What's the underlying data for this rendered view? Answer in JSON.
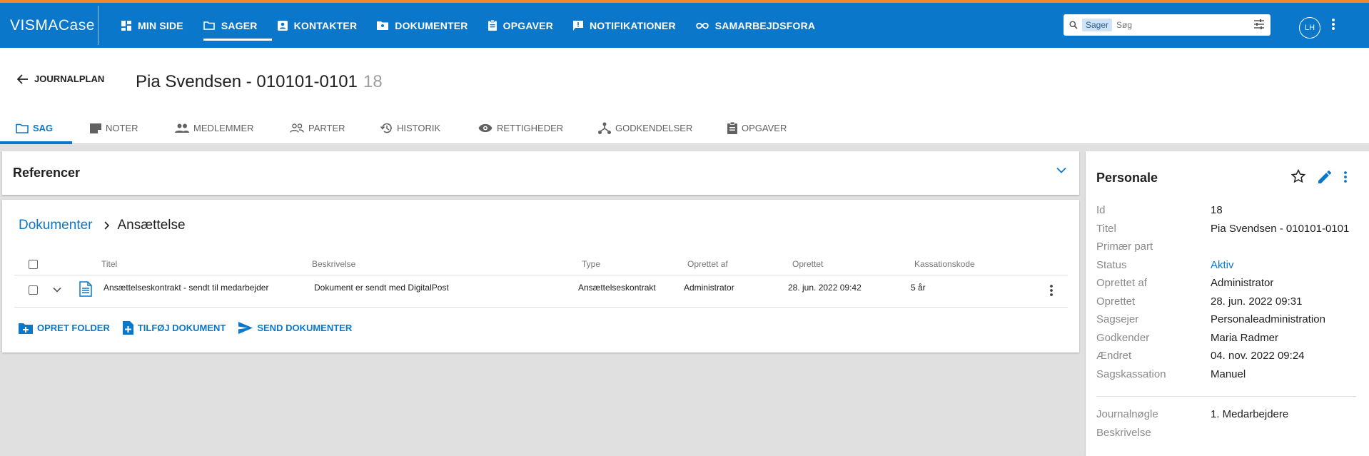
{
  "app": {
    "logo_primary": "VISMA",
    "logo_secondary": "Case",
    "colors": {
      "brand": "#0a77cb",
      "accent_stripe": "#f0872a"
    }
  },
  "topnav": {
    "items": [
      {
        "label": "MIN SIDE",
        "icon": "dashboard-icon"
      },
      {
        "label": "SAGER",
        "icon": "folder-icon",
        "active": true
      },
      {
        "label": "KONTAKTER",
        "icon": "contact-card-icon"
      },
      {
        "label": "DOKUMENTER",
        "icon": "document-folder-icon"
      },
      {
        "label": "OPGAVER",
        "icon": "clipboard-icon"
      },
      {
        "label": "NOTIFIKATIONER",
        "icon": "notification-icon"
      },
      {
        "label": "SAMARBEJDSFORA",
        "icon": "infinity-icon"
      }
    ],
    "search": {
      "scope_chip": "Sager",
      "placeholder": "Søg"
    },
    "avatar_initials": "LH"
  },
  "header": {
    "back_label": "JOURNALPLAN",
    "case_title": "Pia Svendsen - 010101-0101",
    "case_id": "18",
    "tabs": [
      {
        "label": "SAG",
        "icon": "folder-outline-icon",
        "active": true
      },
      {
        "label": "NOTER",
        "icon": "note-icon"
      },
      {
        "label": "MEDLEMMER",
        "icon": "people-icon"
      },
      {
        "label": "PARTER",
        "icon": "people-outline-icon"
      },
      {
        "label": "HISTORIK",
        "icon": "history-icon"
      },
      {
        "label": "RETTIGHEDER",
        "icon": "eye-icon"
      },
      {
        "label": "GODKENDELSER",
        "icon": "approval-flow-icon"
      },
      {
        "label": "OPGAVER",
        "icon": "clipboard-icon"
      }
    ]
  },
  "references": {
    "title": "Referencer"
  },
  "documents": {
    "breadcrumb_root": "Dokumenter",
    "breadcrumb_current": "Ansættelse",
    "columns": [
      "Titel",
      "Beskrivelse",
      "Type",
      "Oprettet af",
      "Oprettet",
      "Kassationskode"
    ],
    "rows": [
      {
        "title": "Ansættelseskontrakt - sendt til medarbejder",
        "description": "Dokument er sendt med DigitalPost",
        "type": "Ansættelseskontrakt",
        "created_by": "Administrator",
        "created": "28. jun. 2022 09:42",
        "retention": "5 år"
      }
    ],
    "actions": {
      "create_folder": "OPRET FOLDER",
      "add_document": "TILFØJ DOKUMENT",
      "send_documents": "SEND DOKUMENTER"
    }
  },
  "sidepanel": {
    "title": "Personale",
    "fields": [
      {
        "label": "Id",
        "value": "18"
      },
      {
        "label": "Titel",
        "value": "Pia Svendsen - 010101-0101"
      },
      {
        "label": "Primær part",
        "value": ""
      },
      {
        "label": "Status",
        "value": "Aktiv"
      },
      {
        "label": "Oprettet af",
        "value": "Administrator"
      },
      {
        "label": "Oprettet",
        "value": "28. jun. 2022 09:31"
      },
      {
        "label": "Sagsejer",
        "value": "Personaleadministration"
      },
      {
        "label": "Godkender",
        "value": "Maria Radmer"
      },
      {
        "label": "Ændret",
        "value": "04. nov. 2022 09:24"
      },
      {
        "label": "Sagskassation",
        "value": "Manuel"
      }
    ],
    "extra_fields": [
      {
        "label": "Journalnøgle",
        "value": "1. Medarbejdere"
      },
      {
        "label": "Beskrivelse",
        "value": ""
      }
    ]
  }
}
